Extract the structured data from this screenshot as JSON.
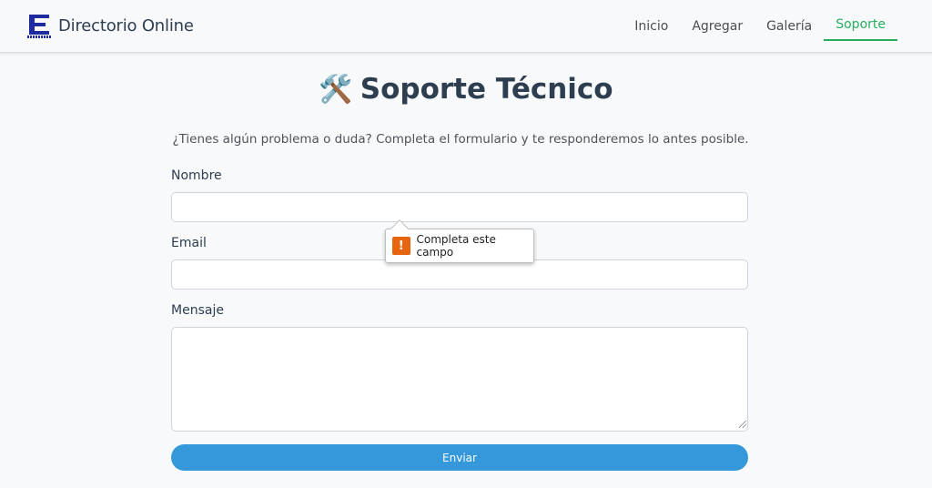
{
  "header": {
    "brand_title": "Directorio Online",
    "brand_icon": "directory-logo-icon",
    "nav": [
      {
        "label": "Inicio",
        "active": false
      },
      {
        "label": "Agregar",
        "active": false
      },
      {
        "label": "Galería",
        "active": false
      },
      {
        "label": "Soporte",
        "active": true
      }
    ],
    "active_color": "#27ae60"
  },
  "main": {
    "title_icon": "🛠️",
    "title": "Soporte Técnico",
    "subtitle": "¿Tienes algún problema o duda? Completa el formulario y te responderemos lo antes posible."
  },
  "form": {
    "name_label": "Nombre",
    "name_value": "",
    "email_label": "Email",
    "email_value": "",
    "message_label": "Mensaje",
    "message_value": "",
    "submit_label": "Enviar",
    "submit_color": "#3498db"
  },
  "validation": {
    "icon": "warning-icon",
    "message": "Completa este campo",
    "icon_color": "#e8650f"
  }
}
